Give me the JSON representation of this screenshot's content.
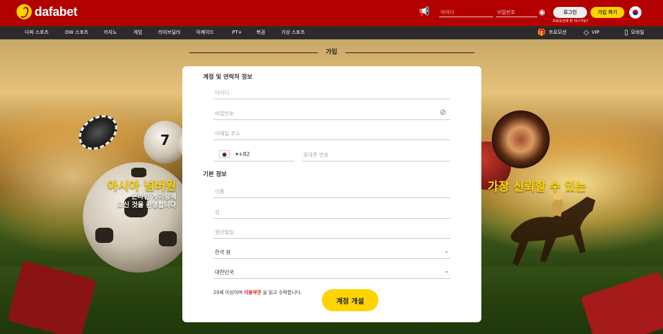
{
  "header": {
    "brand": "dafabet",
    "username_placeholder": "아이디",
    "password_placeholder": "비밀번호",
    "login_label": "로그인",
    "join_label": "가입 하기"
  },
  "nav": {
    "items": [
      "다파 스포츠",
      "OW 스포츠",
      "카지노",
      "게임",
      "라이브딜러",
      "아케이드",
      "PT+",
      "복권",
      "가상 스포츠"
    ],
    "promotions": "프로모션",
    "vip": "VIP",
    "mobile": "모바일",
    "promo_tip": "프로모션에 맞 지나가요?"
  },
  "promo": {
    "left_headline": "아시아 넘버원",
    "left_line1": "온라인 게이밍에",
    "left_line2": "오신 것을 환영합니다",
    "right_headline": "가장 신뢰할 수 있는"
  },
  "form": {
    "title": "가입",
    "section_account": "계정 및 연락처 정보",
    "username_placeholder": "아이디",
    "password_placeholder": "비밀번호",
    "email_placeholder": "이메일 주소",
    "country_code": "▾+82",
    "phone_placeholder": "휴대폰 번호",
    "section_basic": "기본 정보",
    "first_name_placeholder": "이름",
    "last_name_placeholder": "성",
    "birthdate_placeholder": "생년월일",
    "currency_value": "한국 원",
    "country_value": "대한민국",
    "terms_prefix": "20세 이상이며",
    "terms_link": "이용약관",
    "terms_suffix": "을 읽고 수락합니다.",
    "submit_label": "계정 개설"
  },
  "colors": {
    "header_red": "#b30000",
    "nav_dark": "#2b2b2b",
    "accent_yellow": "#ffd400",
    "link_red": "#d81b1b"
  }
}
